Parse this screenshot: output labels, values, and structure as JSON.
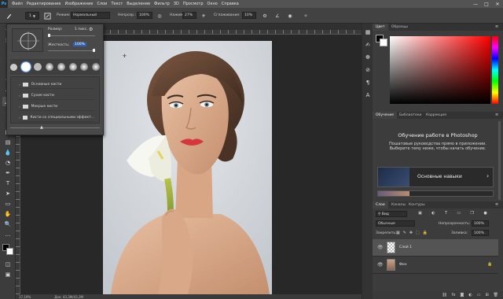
{
  "app": {
    "logo": "Ps"
  },
  "menu": {
    "items": [
      "Файл",
      "Редактирование",
      "Изображение",
      "Слои",
      "Текст",
      "Выделение",
      "Фильтр",
      "3D",
      "Просмотр",
      "Окно",
      "Справка"
    ]
  },
  "window_controls": {
    "minimize": "—",
    "maximize": "□",
    "close": "✕"
  },
  "options": {
    "mode_label": "Режим:",
    "mode_value": "Нормальный",
    "opacity_label": "Непрозр.:",
    "opacity_value": "100%",
    "flow_label": "Нажим:",
    "flow_value": "27%",
    "smoothing_label": "Сглаживание:",
    "smoothing_value": "10%",
    "brush_size": "1"
  },
  "brush_popup": {
    "size_label": "Размер:",
    "size_value": "1 пикс.",
    "hardness_label": "Жесткость:",
    "hardness_value": "100%",
    "folders": [
      "Основные кисти",
      "Сухие кисти",
      "Мокрые кисти",
      "Кисти со специальными эффект..."
    ]
  },
  "tools": {
    "icons": [
      "move-icon",
      "marquee-icon",
      "lasso-icon",
      "magic-wand-icon",
      "crop-icon",
      "eyedropper-icon",
      "healing-icon",
      "brush-icon",
      "stamp-icon",
      "history-brush-icon",
      "eraser-icon",
      "gradient-icon",
      "blur-icon",
      "dodge-icon",
      "pen-icon",
      "type-icon",
      "path-select-icon",
      "shape-icon",
      "hand-icon",
      "zoom-icon",
      "more-icon"
    ]
  },
  "status": {
    "zoom": "17,19%",
    "doc": "Док: 43,3M/43,3M"
  },
  "panels": {
    "color_tabs": [
      "Цвет",
      "Образцы"
    ],
    "learn_tabs": [
      "Обучение",
      "Библиотеки",
      "Коррекция"
    ],
    "learn_title": "Обучение работе в Photoshop",
    "learn_desc": "Пошаговые руководства прямо в приложении. Выберите тему ниже, чтобы начать обучение.",
    "learn_card": "Основные навыки",
    "layers_tabs": [
      "Слои",
      "Каналы",
      "Контуры"
    ],
    "layers_kind": "Вид",
    "layers_blend": "Обычные",
    "layers_opacity_label": "Непрозрачность:",
    "layers_opacity_value": "100%",
    "layers_lock_label": "Закрепить:",
    "layers_fill_label": "Заливка:",
    "layers_fill_value": "100%",
    "layers": [
      {
        "name": "Слой 1"
      },
      {
        "name": "Фон"
      }
    ]
  },
  "colors": {
    "accent": "#31a8ff",
    "foreground": "#000000",
    "background": "#ffffff"
  }
}
